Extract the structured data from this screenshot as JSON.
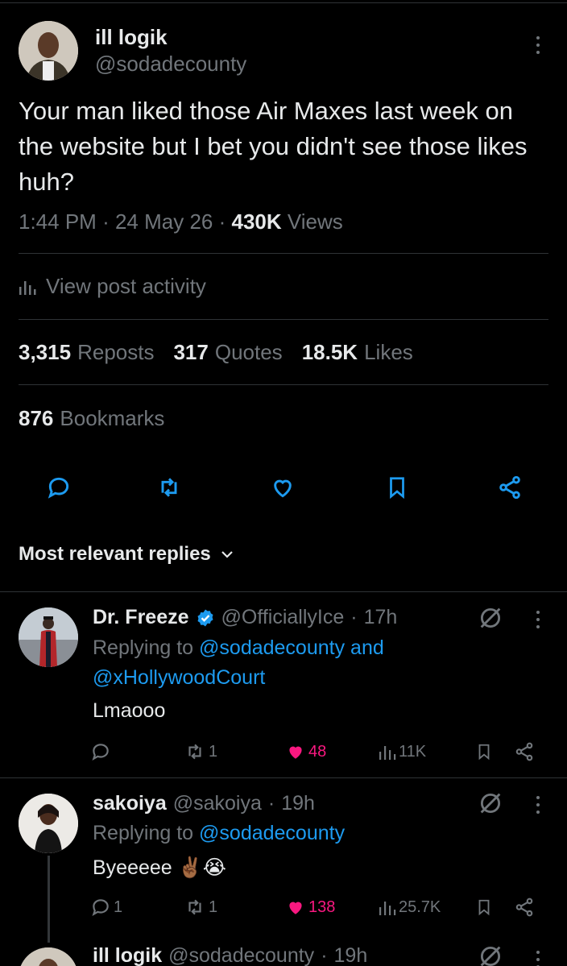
{
  "main": {
    "name": "ill logik",
    "handle": "@sodadecounty",
    "text": "Your man liked those Air Maxes last week on the website but I bet you didn't see those likes huh?",
    "time": "1:44 PM",
    "date": "24 May 26",
    "views_count": "430K",
    "views_label": "Views",
    "activity_label": "View post activity",
    "reposts_count": "3,315",
    "reposts_label": "Reposts",
    "quotes_count": "317",
    "quotes_label": "Quotes",
    "likes_count": "18.5K",
    "likes_label": "Likes",
    "bookmarks_count": "876",
    "bookmarks_label": "Bookmarks"
  },
  "replies_header": "Most relevant replies",
  "replies": [
    {
      "name": "Dr. Freeze",
      "handle": "@OfficiallyIce",
      "time": "17h",
      "replying_prefix": "Replying to",
      "replying_to_1": "@sodadecounty",
      "replying_and": "and",
      "replying_to_2": "@xHollywoodCourt",
      "text": "Lmaooo",
      "replies_count": "",
      "reposts_count": "1",
      "likes_count": "48",
      "views_count": "11K"
    },
    {
      "name": "sakoiya",
      "handle": "@sakoiya",
      "time": "19h",
      "replying_prefix": "Replying to",
      "replying_to_1": "@sodadecounty",
      "text": "Byeeeee ✌🏾😭",
      "replies_count": "1",
      "reposts_count": "1",
      "likes_count": "138",
      "views_count": "25.7K"
    },
    {
      "name": "ill logik",
      "handle": "@sodadecounty",
      "time": "19h"
    }
  ],
  "colors": {
    "background": "#000000",
    "text": "#e7e9ea",
    "muted": "#71767b",
    "link": "#1d9bf0",
    "like": "#f91880",
    "divider": "#2f3336"
  }
}
